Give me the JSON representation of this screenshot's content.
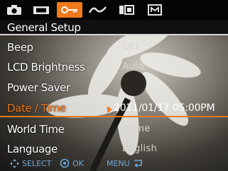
{
  "tabs": [
    {
      "icon": "camera-icon"
    },
    {
      "icon": "video-icon"
    },
    {
      "icon": "setup-key-icon",
      "active": true
    },
    {
      "icon": "wave-icon"
    },
    {
      "icon": "display-icon"
    },
    {
      "icon": "memory-icon"
    }
  ],
  "section": {
    "title": "General Setup"
  },
  "menu": [
    {
      "label": "Beep",
      "value": "OFF"
    },
    {
      "label": "LCD Brightness",
      "value": "Auto"
    },
    {
      "label": "Power Saver",
      "value": ""
    },
    {
      "label": "Date / Time",
      "value": "2011/01/17 05:00PM",
      "selected": true
    },
    {
      "label": "World Time",
      "value": "Home"
    },
    {
      "label": "Language",
      "value": "English"
    }
  ],
  "hints": {
    "select": "SELECT",
    "ok": "OK",
    "menu": "MENU"
  },
  "colors": {
    "accent": "#f07a1c",
    "hint": "#6fa6d8"
  }
}
